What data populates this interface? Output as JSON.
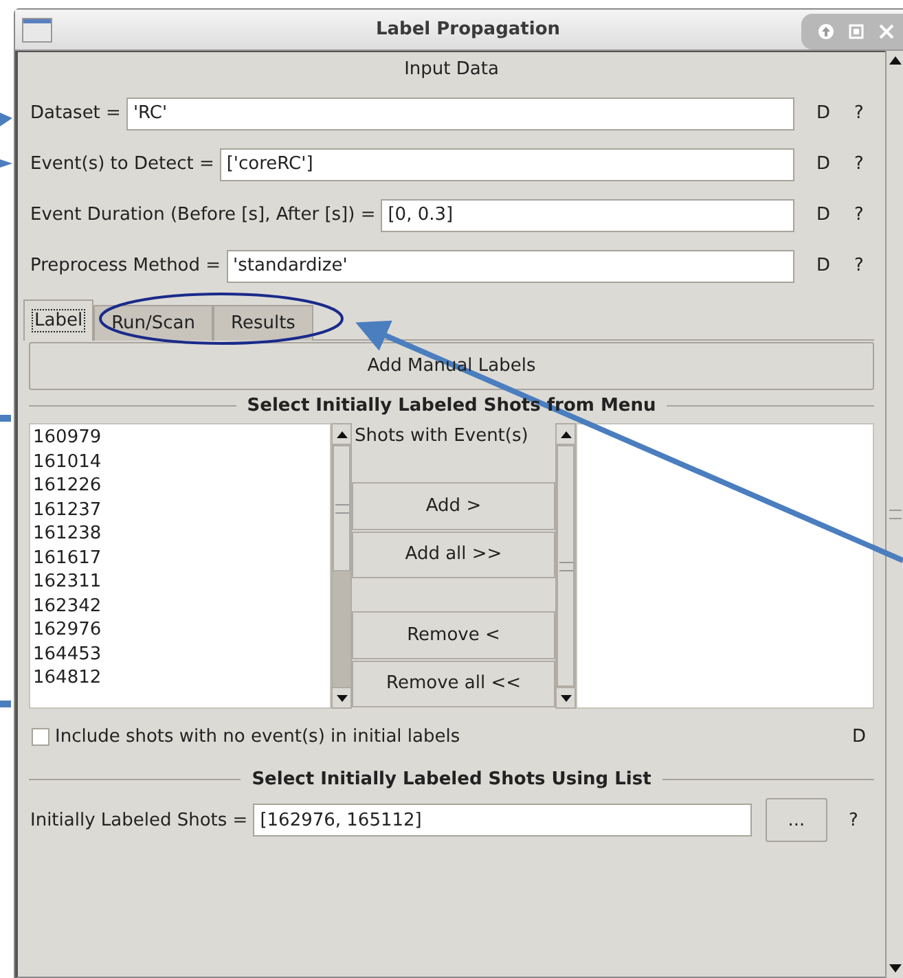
{
  "window": {
    "title": "Label Propagation"
  },
  "input_data": {
    "heading": "Input Data",
    "fields": [
      {
        "label": "Dataset =",
        "value": "'RC'",
        "default_button": "D",
        "help_button": "?"
      },
      {
        "label": "Event(s) to Detect =",
        "value": "['coreRC']",
        "default_button": "D",
        "help_button": "?"
      },
      {
        "label": "Event Duration (Before [s], After [s]) =",
        "value": "[0, 0.3]",
        "default_button": "D",
        "help_button": "?"
      },
      {
        "label": "Preprocess Method =",
        "value": "'standardize'",
        "default_button": "D",
        "help_button": "?"
      }
    ]
  },
  "tabs": [
    {
      "label": "Label",
      "selected": true
    },
    {
      "label": "Run/Scan",
      "selected": false
    },
    {
      "label": "Results",
      "selected": false
    }
  ],
  "label_tab": {
    "add_button": "Add Manual Labels",
    "menu_section": {
      "title": "Select Initially Labeled Shots from Menu",
      "available_shots": [
        "160979",
        "161014",
        "161226",
        "161237",
        "161238",
        "161617",
        "162311",
        "162342",
        "162976",
        "164453",
        "164812"
      ],
      "chosen_header": "Shots with Event(s)",
      "buttons": [
        "Add >",
        "Add all >>",
        "Remove <",
        "Remove all <<"
      ]
    },
    "include_checkbox": {
      "label": "Include shots with no event(s) in initial labels",
      "checked": false,
      "default_button": "D"
    },
    "list_section": {
      "title": "Select Initially Labeled Shots Using List",
      "label": "Initially Labeled Shots =",
      "value": "[162976, 165112]",
      "browse_button": "...",
      "help_button": "?"
    }
  }
}
